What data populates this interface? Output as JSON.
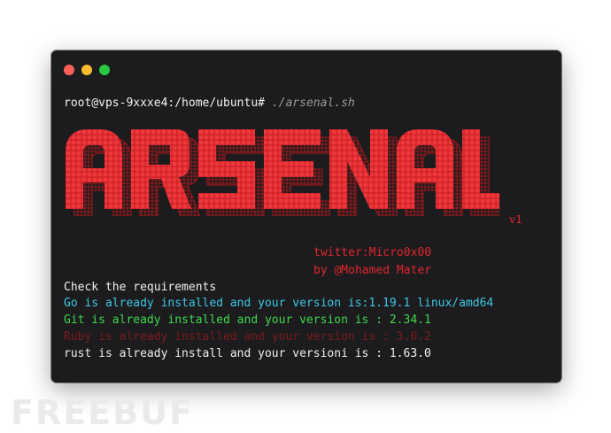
{
  "window": {
    "controls": [
      "close",
      "minimize",
      "maximize"
    ]
  },
  "terminal": {
    "prompt": "root@vps-9xxxe4:/home/ubuntu# ",
    "command": "./arsenal.sh",
    "banner_text": "ARSENAL",
    "version_tag": "v1",
    "twitter": "twitter:Micro0x00",
    "author": "by @Mohamed Mater",
    "lines": [
      "Check the requirements",
      "Go is already installed and your version is:1.19.1 linux/amd64",
      "Git is already installed and your version is : 2.34.1",
      "Ruby is already installed and your version is : 3.0.2",
      "rust is already install and your versioni is : 1.63.0"
    ]
  },
  "colors": {
    "banner_red": "#e0262b",
    "background": "#1c1c1e",
    "cyan": "#3ec7e6",
    "green": "#3fd84b",
    "dark_red": "#7d1a1c"
  },
  "watermark": "FREEBUF"
}
